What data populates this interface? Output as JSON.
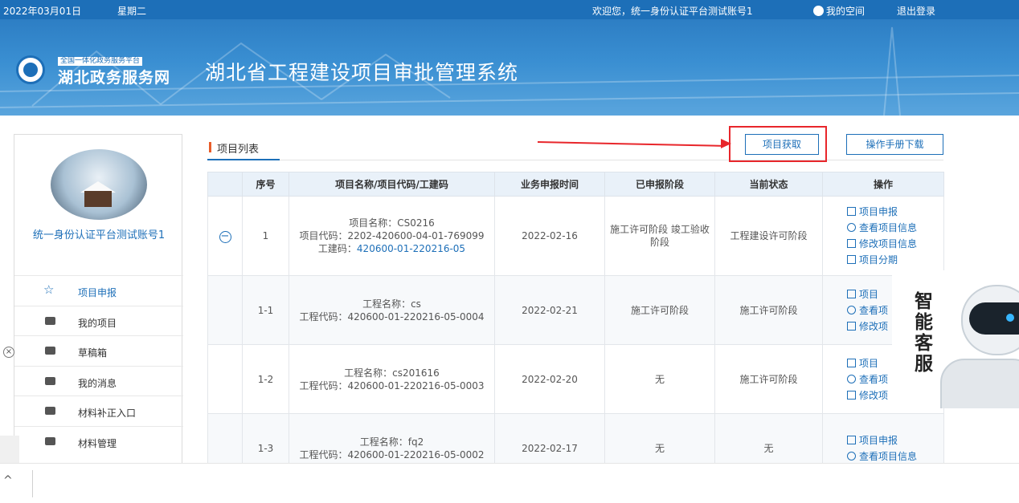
{
  "topbar": {
    "date": "2022年03月01日",
    "weekday": "星期二",
    "welcome": "欢迎您，统一身份认证平台测试账号1",
    "my_space": "我的空间",
    "logout": "退出登录"
  },
  "banner": {
    "logo_tag": "全国一体化政务服务平台",
    "logo_name": "湖北政务服务网",
    "system_title": "湖北省工程建设项目审批管理系统"
  },
  "sidebar": {
    "user_name": "统一身份认证平台测试账号1",
    "items": [
      {
        "label": "项目申报",
        "icon": "star-icon"
      },
      {
        "label": "我的项目",
        "icon": "folder-icon"
      },
      {
        "label": "草稿箱",
        "icon": "draft-icon"
      },
      {
        "label": "我的消息",
        "icon": "message-icon"
      },
      {
        "label": "材料补正入口",
        "icon": "material-fix-icon"
      },
      {
        "label": "材料管理",
        "icon": "material-manage-icon"
      }
    ]
  },
  "main": {
    "tab_label": "项目列表",
    "fetch_button": "项目获取",
    "manual_button": "操作手册下载",
    "columns": [
      "序号",
      "项目名称/项目代码/工建码",
      "业务申报时间",
      "已申报阶段",
      "当前状态",
      "操作"
    ],
    "rows": [
      {
        "seq": "1",
        "line1": "项目名称：CS0216",
        "line2": "项目代码：2202-420600-04-01-769099",
        "gcode_label": "工建码：",
        "gcode": "420600-01-220216-05",
        "time": "2022-02-16",
        "stage": "施工许可阶段 竣工验收阶段",
        "status": "工程建设许可阶段",
        "ops": [
          "项目申报",
          "查看项目信息",
          "修改项目信息",
          "项目分期"
        ]
      },
      {
        "seq": "1-1",
        "line1": "工程名称：cs",
        "line2": "工程代码：420600-01-220216-05-0004",
        "time": "2022-02-21",
        "stage": "施工许可阶段",
        "status": "施工许可阶段",
        "ops": [
          "项目",
          "查看项",
          "修改项"
        ]
      },
      {
        "seq": "1-2",
        "line1": "工程名称：cs201616",
        "line2": "工程代码：420600-01-220216-05-0003",
        "time": "2022-02-20",
        "stage": "无",
        "status": "施工许可阶段",
        "ops": [
          "项目",
          "查看项",
          "修改项"
        ]
      },
      {
        "seq": "1-3",
        "line1": "工程名称：fq2",
        "line2": "工程代码：420600-01-220216-05-0002",
        "time": "2022-02-17",
        "stage": "无",
        "status": "无",
        "ops": [
          "项目申报",
          "查看项目信息"
        ]
      }
    ]
  },
  "robot": {
    "label": "智能客服"
  },
  "colors": {
    "primary": "#1d6fb8",
    "accent_red": "#e8262b",
    "tab_bar": "#e85d2a"
  }
}
